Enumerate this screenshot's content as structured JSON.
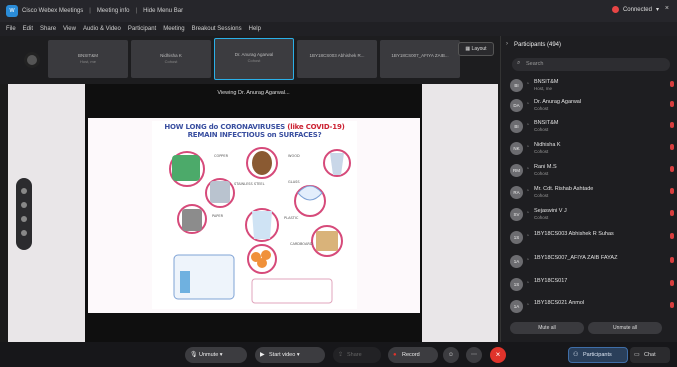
{
  "titlebar": {
    "app_title": "Cisco Webex Meetings",
    "meeting_info": "Meeting info",
    "hide_menu": "Hide Menu Bar",
    "connected": "Connected"
  },
  "menu": [
    "File",
    "Edit",
    "Share",
    "View",
    "Audio & Video",
    "Participant",
    "Meeting",
    "Breakout Sessions",
    "Help"
  ],
  "filmstrip": {
    "tiles": [
      {
        "name": "BNSIT&M",
        "sub": "Host, me"
      },
      {
        "name": "Nidhisha K",
        "sub": "Cohost"
      },
      {
        "name": "Dr. Anurag Agarwal",
        "sub": "Cohost"
      },
      {
        "name": "1BY18CS003 Abhishek R...",
        "sub": ""
      },
      {
        "name": "1BY18CS007_AFIYA ZAIB...",
        "sub": ""
      }
    ],
    "layout_label": "Layout"
  },
  "share": {
    "viewing_label": "Viewing Dr. Anurag Agarwal...",
    "slide_title_1": "HOW LONG do CORONAVIRUSES",
    "slide_title_paren": "(like COVID-19)",
    "slide_title_2": "REMAIN INFECTIOUS on SURFACES?"
  },
  "participants": {
    "title": "Participants (494)",
    "search_placeholder": "Search",
    "list": [
      {
        "initials": "BI",
        "name": "BNSIT&M",
        "role": "Host, me"
      },
      {
        "initials": "DA",
        "name": "Dr. Anurag Agarwal",
        "role": "Cohost"
      },
      {
        "initials": "BI",
        "name": "BNSIT&M",
        "role": "Cohost"
      },
      {
        "initials": "NK",
        "name": "Nidhisha K",
        "role": "Cohost"
      },
      {
        "initials": "RM",
        "name": "Rani M.S",
        "role": "Cohost"
      },
      {
        "initials": "RA",
        "name": "Mr. Cdt. Rishab Ashtade",
        "role": "Cohost"
      },
      {
        "initials": "SV",
        "name": "Sejaswini V J",
        "role": "Cohost"
      },
      {
        "initials": "1S",
        "name": "1BY18CS003 Abhishek R Suhas",
        "role": ""
      },
      {
        "initials": "1A",
        "name": "1BY18CS007_AFIYA ZAIB FAYAZ",
        "role": ""
      },
      {
        "initials": "1S",
        "name": "1BY18CS017",
        "role": ""
      },
      {
        "initials": "1A",
        "name": "1BY18CS021 Anmol",
        "role": ""
      }
    ],
    "mute_all": "Mute all",
    "unmute_all": "Unmute all"
  },
  "controls": {
    "unmute": "Unmute",
    "start_video": "Start video",
    "share": "Share",
    "record": "Record",
    "participants_tab": "Participants",
    "chat_tab": "Chat"
  },
  "colors": {
    "accent": "#2bb0e8",
    "end_red": "#e0332b",
    "mic_red": "#d73e3e"
  }
}
